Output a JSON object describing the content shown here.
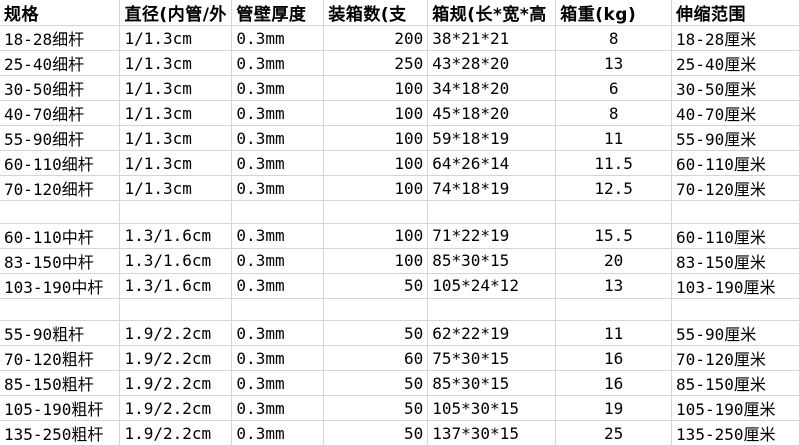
{
  "headers": [
    "规格",
    "直径（内管/外管）",
    "壁厚度",
    "装箱数（支）",
    "箱规（长*宽*高）",
    "箱重（kg）",
    "伸缩范围"
  ],
  "header_display": [
    "规格",
    "直径(内管/外",
    "管壁厚度",
    "装箱数(支",
    "箱规(长*宽*高",
    "箱重(kg)",
    "伸缩范围"
  ],
  "groups": [
    {
      "rows": [
        [
          "18-28细杆",
          "1/1.3cm",
          "0.3mm",
          "200",
          "38*21*21",
          "8",
          "18-28厘米"
        ],
        [
          "25-40细杆",
          "1/1.3cm",
          "0.3mm",
          "250",
          "43*28*20",
          "13",
          "25-40厘米"
        ],
        [
          "30-50细杆",
          "1/1.3cm",
          "0.3mm",
          "100",
          "34*18*20",
          "6",
          "30-50厘米"
        ],
        [
          "40-70细杆",
          "1/1.3cm",
          "0.3mm",
          "100",
          "45*18*20",
          "8",
          "40-70厘米"
        ],
        [
          "55-90细杆",
          "1/1.3cm",
          "0.3mm",
          "100",
          "59*18*19",
          "11",
          "55-90厘米"
        ],
        [
          "60-110细杆",
          "1/1.3cm",
          "0.3mm",
          "100",
          "64*26*14",
          "11.5",
          "60-110厘米"
        ],
        [
          "70-120细杆",
          "1/1.3cm",
          "0.3mm",
          "100",
          "74*18*19",
          "12.5",
          "70-120厘米"
        ]
      ]
    },
    {
      "rows": [
        [
          "60-110中杆",
          "1.3/1.6cm",
          "0.3mm",
          "100",
          "71*22*19",
          "15.5",
          "60-110厘米"
        ],
        [
          "83-150中杆",
          "1.3/1.6cm",
          "0.3mm",
          "100",
          "85*30*15",
          "20",
          "83-150厘米"
        ],
        [
          "103-190中杆",
          "1.3/1.6cm",
          "0.3mm",
          "50",
          "105*24*12",
          "13",
          "103-190厘米"
        ]
      ]
    },
    {
      "rows": [
        [
          "55-90粗杆",
          "1.9/2.2cm",
          "0.3mm",
          "50",
          "62*22*19",
          "11",
          "55-90厘米"
        ],
        [
          "70-120粗杆",
          "1.9/2.2cm",
          "0.3mm",
          "60",
          "75*30*15",
          "16",
          "70-120厘米"
        ],
        [
          "85-150粗杆",
          "1.9/2.2cm",
          "0.3mm",
          "50",
          "85*30*15",
          "16",
          "85-150厘米"
        ],
        [
          "105-190粗杆",
          "1.9/2.2cm",
          "0.3mm",
          "50",
          "105*30*15",
          "19",
          "105-190厘米"
        ],
        [
          "135-250粗杆",
          "1.9/2.2cm",
          "0.3mm",
          "50",
          "137*30*15",
          "25",
          "135-250厘米"
        ]
      ]
    }
  ]
}
